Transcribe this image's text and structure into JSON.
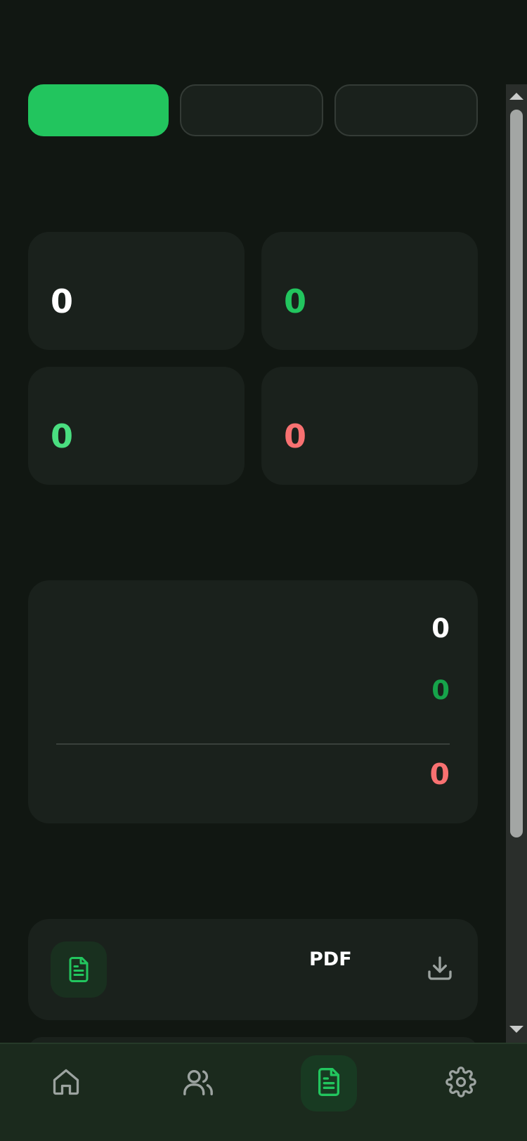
{
  "tabs": [
    {
      "label": "",
      "active": true
    },
    {
      "label": "",
      "active": false
    },
    {
      "label": "",
      "active": false
    }
  ],
  "stats": [
    {
      "value": "0",
      "color": "#ffffff"
    },
    {
      "value": "0",
      "color": "#22c55e"
    },
    {
      "value": "0",
      "color": "#4ade80"
    },
    {
      "value": "0",
      "color": "#f87171"
    }
  ],
  "summary": {
    "row1": "0",
    "row2": "0",
    "row3": "0",
    "colors": {
      "row1": "#ffffff",
      "row2": "#16a34a",
      "row3": "#f87171"
    }
  },
  "export": {
    "label": "PDF",
    "icon": "document-icon",
    "action_icon": "download-icon"
  },
  "nav": [
    {
      "icon": "home-icon",
      "active": false
    },
    {
      "icon": "users-icon",
      "active": false
    },
    {
      "icon": "document-icon",
      "active": true
    },
    {
      "icon": "gear-icon",
      "active": false
    }
  ],
  "colors": {
    "accent": "#22c55e",
    "background": "#111712",
    "card": "#1a211c",
    "nav_background": "#1b2a1d",
    "icon_inactive": "#9ca3a0"
  }
}
